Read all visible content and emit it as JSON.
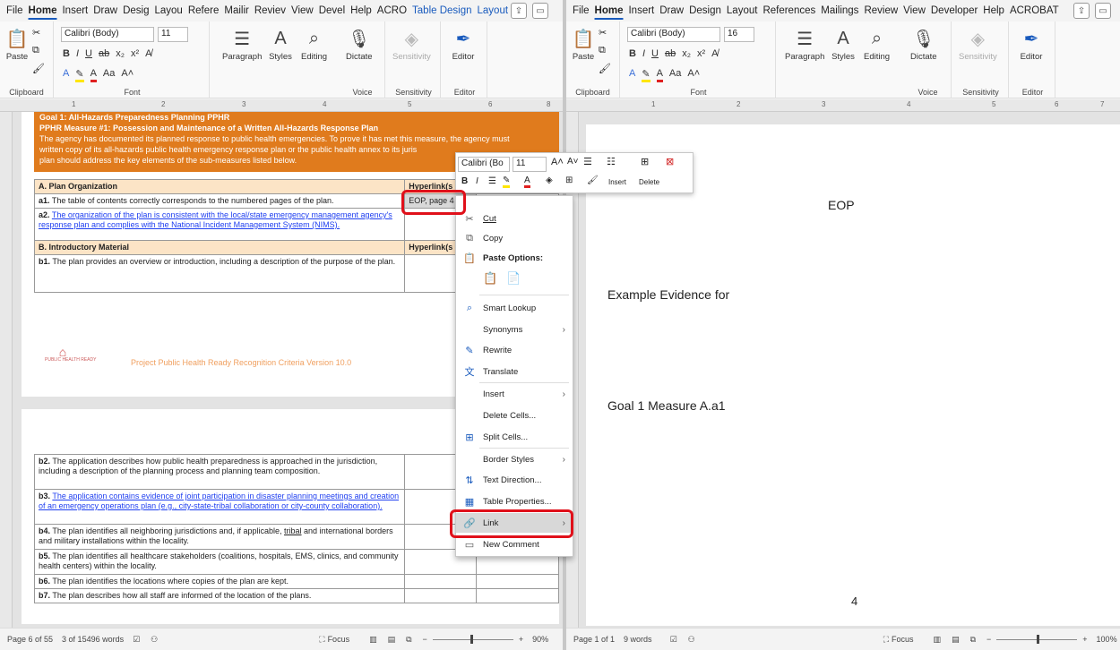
{
  "left": {
    "menu": [
      "File",
      "Home",
      "Insert",
      "Draw",
      "Desig",
      "Layou",
      "Refere",
      "Mailir",
      "Reviev",
      "View",
      "Devel",
      "Help",
      "ACRO",
      "Table Design",
      "Layout"
    ],
    "ribbon": {
      "clipboard_label": "Clipboard",
      "paste": "Paste",
      "font_name": "Calibri (Body)",
      "font_size": "11",
      "font_label": "Font",
      "paragraph": "Paragraph",
      "styles": "Styles",
      "editing": "Editing",
      "dictate": "Dictate",
      "voice_label": "Voice",
      "sensitivity": "Sensitivity",
      "sensitivity_label": "Sensitivity",
      "editor": "Editor",
      "editor_label": "Editor"
    },
    "doc": {
      "goal_title": "Goal 1: All-Hazards Preparedness Planning PPHR",
      "measure_title": "PPHR Measure #1: Possession and Maintenance of a Written All-Hazards Response Plan",
      "desc1": "The agency has documented its planned response to public health emergencies. To prove it has met this measure, the agency must",
      "desc2": "written copy of its all-hazards public health emergency response plan or the public health annex to its juris",
      "desc3": "plan should address the key elements of the sub-measures listed below.",
      "secA": "A.  Plan Organization",
      "hyper": "Hyperlink(s",
      "a1_id": "a1.",
      "a1": "The table of contents correctly corresponds to the numbered pages of the plan.",
      "a1_cell": "EOP, page 4",
      "a2_id": "a2.",
      "a2": "The organization of the plan is consistent with the local/state emergency management agency's response plan and complies with the National Incident Management System (NIMS).",
      "secB": "B.  Introductory Material",
      "b1_id": "b1.",
      "b1": "The plan provides an overview or introduction, including a description of the purpose of the plan.",
      "logo_text": "PUBLIC HEALTH READY",
      "footer": "Project Public Health Ready Recognition Criteria Version 10.0",
      "b2_id": "b2.",
      "b2": "The application describes how public health preparedness is approached in the jurisdiction, including a description of the planning process and planning team composition.",
      "b3_id": "b3.",
      "b3": "The application contains evidence of joint participation in disaster planning meetings and creation of an emergency operations plan (e.g., city-state-tribal collaboration or city-county collaboration).",
      "b4_id": "b4.",
      "b4_pre": "The plan identifies all neighboring jurisdictions and, if applicable, ",
      "b4_u": "tribal",
      "b4_post": " and international borders and military installations within the locality.",
      "b5_id": "b5.",
      "b5": "The plan identifies all healthcare stakeholders (coalitions, hospitals, EMS, clinics, and community health centers) within the locality.",
      "b6_id": "b6.",
      "b6": "The plan identifies the locations where copies of the plan are kept.",
      "b7_id": "b7.",
      "b7": "The plan describes how all staff are informed of the location of the plans."
    },
    "status": {
      "page": "Page 6 of 55",
      "words": "3 of 15496 words",
      "focus": "Focus",
      "zoom": "90%"
    }
  },
  "minitoolbar": {
    "font": "Calibri (Bo",
    "size": "11",
    "insert": "Insert",
    "delete": "Delete"
  },
  "context_menu": [
    {
      "label": "Cut",
      "icon": "scissors-icon"
    },
    {
      "label": "Copy",
      "icon": "copy-icon"
    },
    {
      "label": "Paste Options:",
      "icon": "paste-icon"
    },
    {
      "label": "Smart Lookup",
      "icon": "search-icon"
    },
    {
      "label": "Synonyms",
      "icon": ""
    },
    {
      "label": "Rewrite",
      "icon": "rewrite-icon"
    },
    {
      "label": "Translate",
      "icon": "translate-icon"
    },
    {
      "label": "Insert",
      "icon": ""
    },
    {
      "label": "Delete Cells...",
      "icon": ""
    },
    {
      "label": "Split Cells...",
      "icon": "split-cells-icon"
    },
    {
      "label": "Border Styles",
      "icon": ""
    },
    {
      "label": "Text Direction...",
      "icon": "text-direction-icon"
    },
    {
      "label": "Table Properties...",
      "icon": "table-properties-icon"
    },
    {
      "label": "Link",
      "icon": "link-icon"
    },
    {
      "label": "New Comment",
      "icon": "comment-icon"
    }
  ],
  "right": {
    "menu": [
      "File",
      "Home",
      "Insert",
      "Draw",
      "Design",
      "Layout",
      "References",
      "Mailings",
      "Review",
      "View",
      "Developer",
      "Help",
      "ACROBAT"
    ],
    "ribbon": {
      "font_name": "Calibri (Body)",
      "font_size": "16"
    },
    "doc": {
      "eop": "EOP",
      "example": "Example Evidence for",
      "goal": "Goal 1 Measure A.a1",
      "pagenum": "4"
    },
    "status": {
      "page": "Page 1 of 1",
      "words": "9 words",
      "focus": "Focus",
      "zoom": "100%"
    }
  },
  "colors": {
    "accent": "#185abd",
    "orange": "#e07b1d",
    "highlight": "#e0101a"
  }
}
